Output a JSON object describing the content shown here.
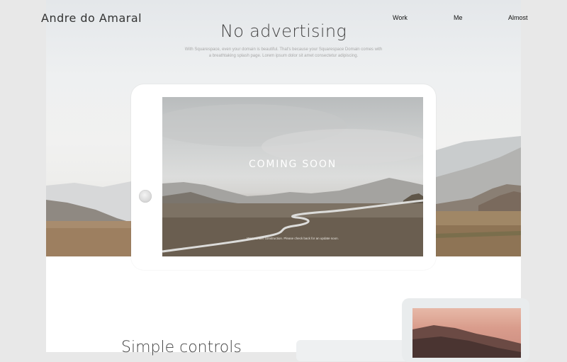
{
  "site": {
    "title": "Andre do Amaral"
  },
  "nav": {
    "items": [
      "Work",
      "Me",
      "Almost"
    ]
  },
  "hero": {
    "headline": "No advertising",
    "subtext": "With Squarespace, even your domain is beautiful. That's because your Squarespace Domain comes with a breathtaking splash page. Lorem ipsum dolor sit amet consectetur adipiscing."
  },
  "tablet": {
    "screen_title": "COMING SOON",
    "screen_note": "We're under construction. Please check back for an update soon."
  },
  "section2": {
    "title": "Simple controls"
  },
  "colors": {
    "page_bg": "#e8e8e8",
    "content_bg": "#ffffff",
    "text": "#444444"
  },
  "icons": {
    "tablet_home_button": "circle"
  }
}
